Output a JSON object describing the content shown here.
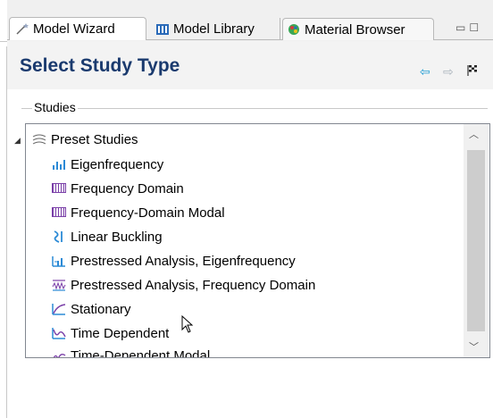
{
  "tabs": [
    {
      "label": "Model Wizard",
      "icon": "wizard-icon",
      "active": true
    },
    {
      "label": "Model Library",
      "icon": "library-icon",
      "active": false
    },
    {
      "label": "Material Browser",
      "icon": "material-icon",
      "active": false
    }
  ],
  "header": {
    "title": "Select Study Type",
    "nav_back_icon": "arrow-left-icon",
    "nav_forward_icon": "arrow-right-icon",
    "finish_icon": "finish-flag-icon"
  },
  "studies": {
    "label": "Studies",
    "root": {
      "label": "Preset Studies",
      "icon": "preset-studies-icon",
      "expanded": true
    },
    "items": [
      {
        "label": "Eigenfrequency",
        "icon": "eigenfrequency-icon"
      },
      {
        "label": "Frequency Domain",
        "icon": "frequency-domain-icon"
      },
      {
        "label": "Frequency-Domain Modal",
        "icon": "frequency-domain-modal-icon"
      },
      {
        "label": "Linear Buckling",
        "icon": "linear-buckling-icon"
      },
      {
        "label": "Prestressed Analysis, Eigenfrequency",
        "icon": "prestressed-eigen-icon"
      },
      {
        "label": "Prestressed Analysis, Frequency Domain",
        "icon": "prestressed-frequency-icon"
      },
      {
        "label": "Stationary",
        "icon": "stationary-icon"
      },
      {
        "label": "Time Dependent",
        "icon": "time-dependent-icon"
      },
      {
        "label": "Time-Dependent Modal",
        "icon": "time-dependent-modal-icon"
      }
    ]
  },
  "colors": {
    "title": "#1a3a6e",
    "nav_active": "#1d9bd3",
    "icon_blue": "#2b8ad6",
    "icon_purple": "#7a3fa8"
  }
}
